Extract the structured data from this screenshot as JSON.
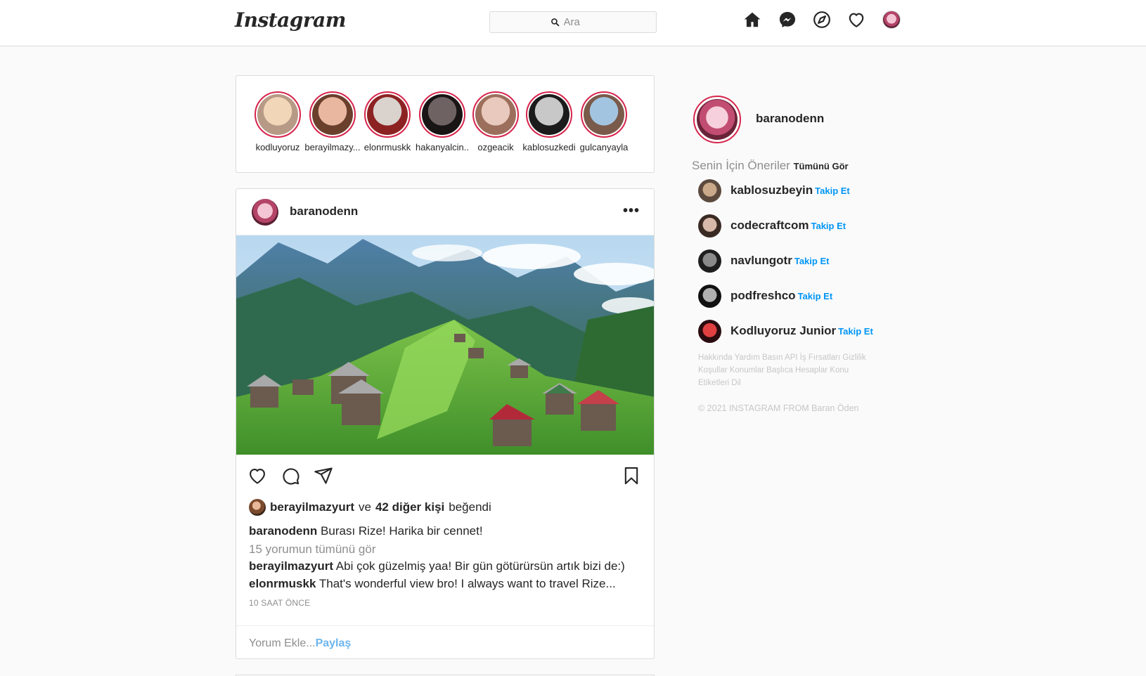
{
  "nav": {
    "logo": "Instagram",
    "search_placeholder": "Ara",
    "icons": [
      "home-icon",
      "messenger-icon",
      "explore-icon",
      "activity-heart-icon",
      "profile-avatar"
    ]
  },
  "stories": [
    {
      "name": "kodluyoruz",
      "colors": [
        "#f2d6b8",
        "#b79a86"
      ]
    },
    {
      "name": "berayilmazy...",
      "colors": [
        "#e9b6a0",
        "#6a3f2c"
      ]
    },
    {
      "name": "elonrmuskk",
      "colors": [
        "#d9d2cd",
        "#8d2222"
      ]
    },
    {
      "name": "hakanyalcin..",
      "colors": [
        "#6f6262",
        "#1a1515"
      ]
    },
    {
      "name": "ozgeacik",
      "colors": [
        "#e9c9bd",
        "#9c6f5c"
      ]
    },
    {
      "name": "kablosuzkedi",
      "colors": [
        "#c8c8c8",
        "#1b1b1b"
      ]
    },
    {
      "name": "gulcanyayla",
      "colors": [
        "#a3c4e0",
        "#7a5a4a"
      ]
    }
  ],
  "post": {
    "username": "baranodenn",
    "liked_by": "berayilmazyurt",
    "liked_conjunction": "ve",
    "liked_others": "42 diğer kişi",
    "liked_suffix": "beğendi",
    "caption_user": "baranodenn",
    "caption_text": "Burası Rize! Harika bir cennet!",
    "view_all_comments": "15 yorumun tümünü gör",
    "comments": [
      {
        "user": "berayilmazyurt",
        "text": "Abi çok güzelmiş yaa! Bir gün götürürsün artık bizi de:)"
      },
      {
        "user": "elonrmuskk",
        "text": "That's wonderful view bro! I always want to travel Rize..."
      }
    ],
    "time": "10 SAAT ÖNCE",
    "comment_placeholder": "Yorum Ekle...",
    "share_label": "Paylaş"
  },
  "sidebar": {
    "username": "baranodenn",
    "suggestions_title": "Senin İçin Öneriler",
    "see_all": "Tümünü Gör",
    "follow_label": "Takip Et",
    "suggestions": [
      {
        "name": "kablosuzbeyin",
        "colors": [
          "#c9a98a",
          "#5c4a3f"
        ]
      },
      {
        "name": "codecraftcom",
        "colors": [
          "#d8b8a8",
          "#3a2a24"
        ]
      },
      {
        "name": "navlungotr",
        "colors": [
          "#8a8a8a",
          "#1e1e1e"
        ]
      },
      {
        "name": "podfreshco",
        "colors": [
          "#b0b0b0",
          "#111111"
        ]
      },
      {
        "name": "Kodluyoruz Junior",
        "colors": [
          "#e04040",
          "#2a0c10"
        ]
      }
    ],
    "footer_links": "Hakkında Yardım Basın API İş Fırsatları Gizlilik Koşullar Konumlar Başlıca Hesaplar Konu Etiketleri Dil",
    "copyright": "© 2021 INSTAGRAM FROM Baran Öden"
  }
}
